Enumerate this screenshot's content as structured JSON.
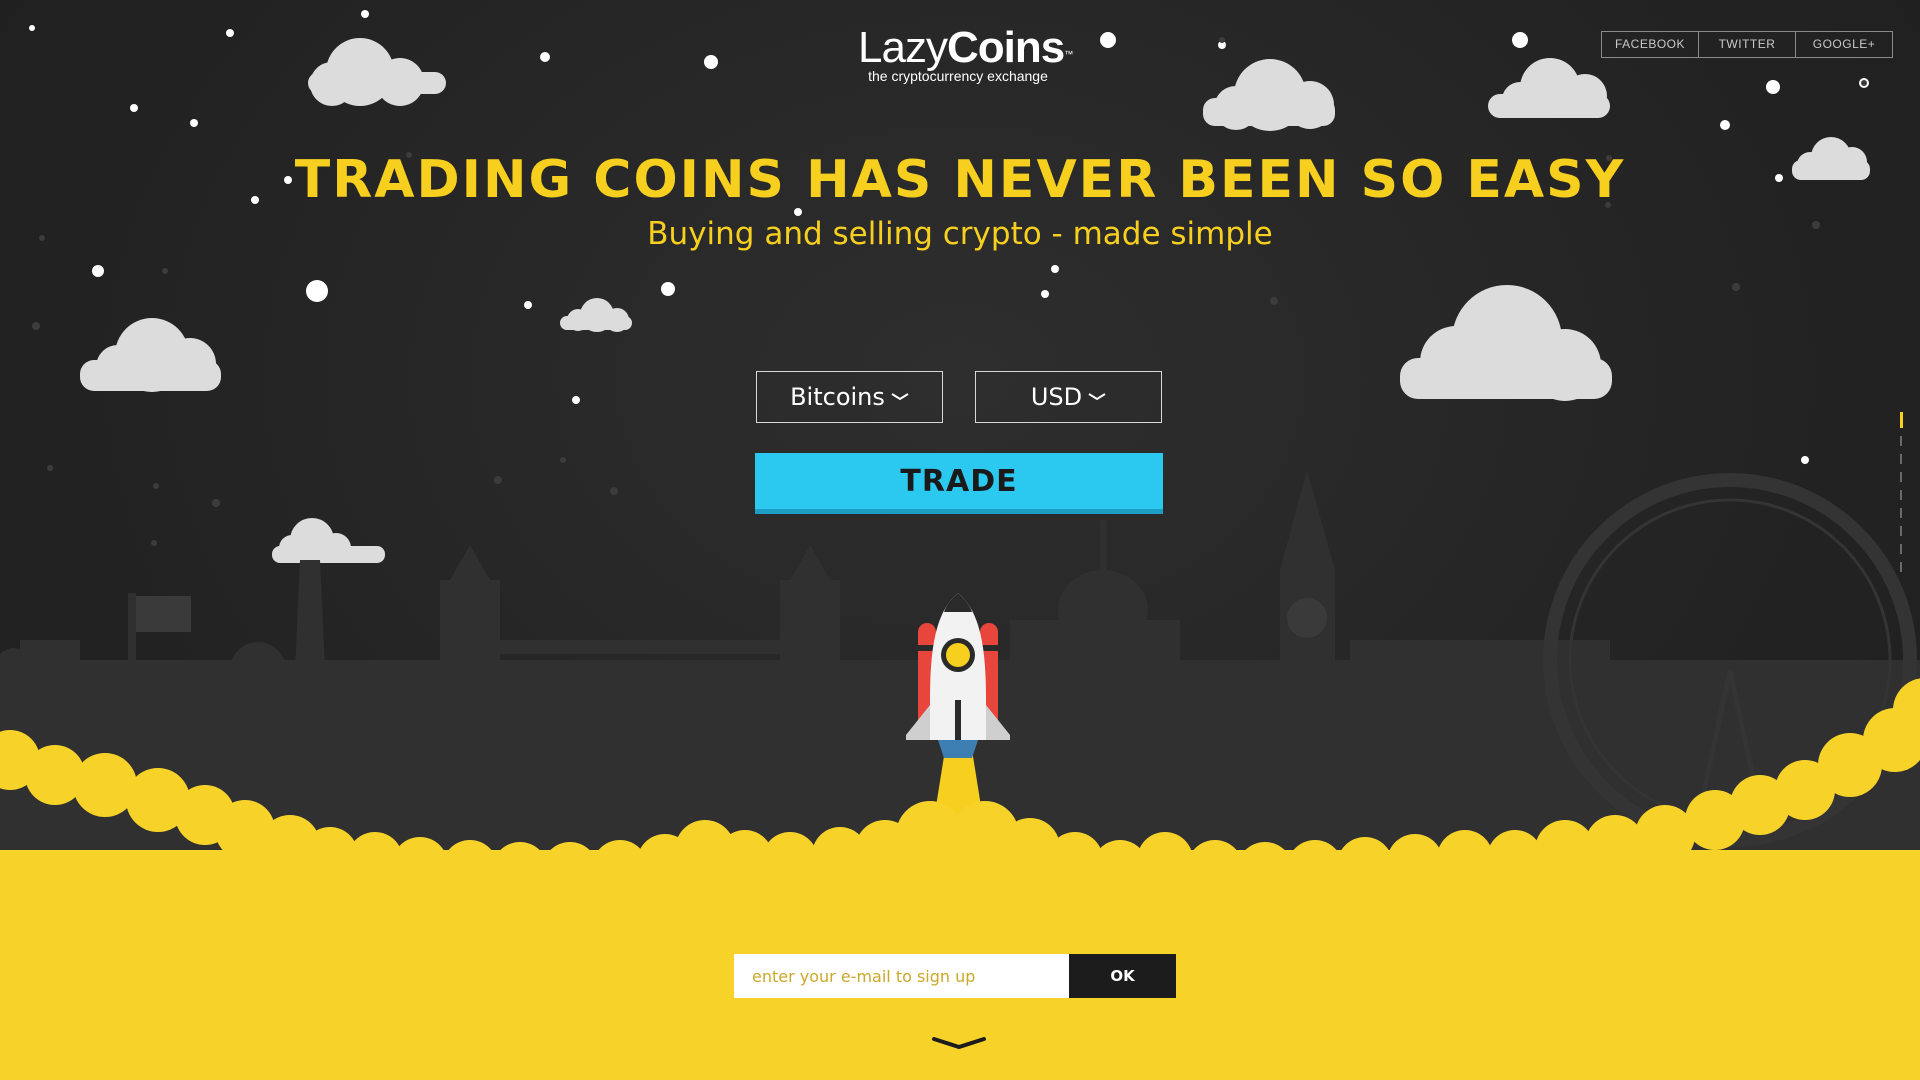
{
  "brand": {
    "name_light": "Lazy",
    "name_bold": "Coins",
    "trademark": "™",
    "tagline": "the cryptocurrency exchange"
  },
  "social": {
    "facebook": "FACEBOOK",
    "twitter": "TWITTER",
    "google": "GOOGLE+"
  },
  "hero": {
    "headline": "TRADING COINS HAS NEVER BEEN SO EASY",
    "subline": "Buying and selling crypto - made simple"
  },
  "trade_form": {
    "coin_select": "Bitcoins",
    "currency_select": "USD",
    "trade_button": "TRADE"
  },
  "signup": {
    "placeholder": "enter your e-mail to sign up",
    "button": "OK"
  },
  "icons": [
    "chevron-down-icon",
    "rocket-icon",
    "cloud-icon",
    "star-icon",
    "city-skyline",
    "scroll-down-icon"
  ],
  "colors": {
    "background": "#262626",
    "accent_yellow": "#f7cf1f",
    "trade_blue": "#2bc9ef",
    "cloud": "#d9d9d9"
  }
}
